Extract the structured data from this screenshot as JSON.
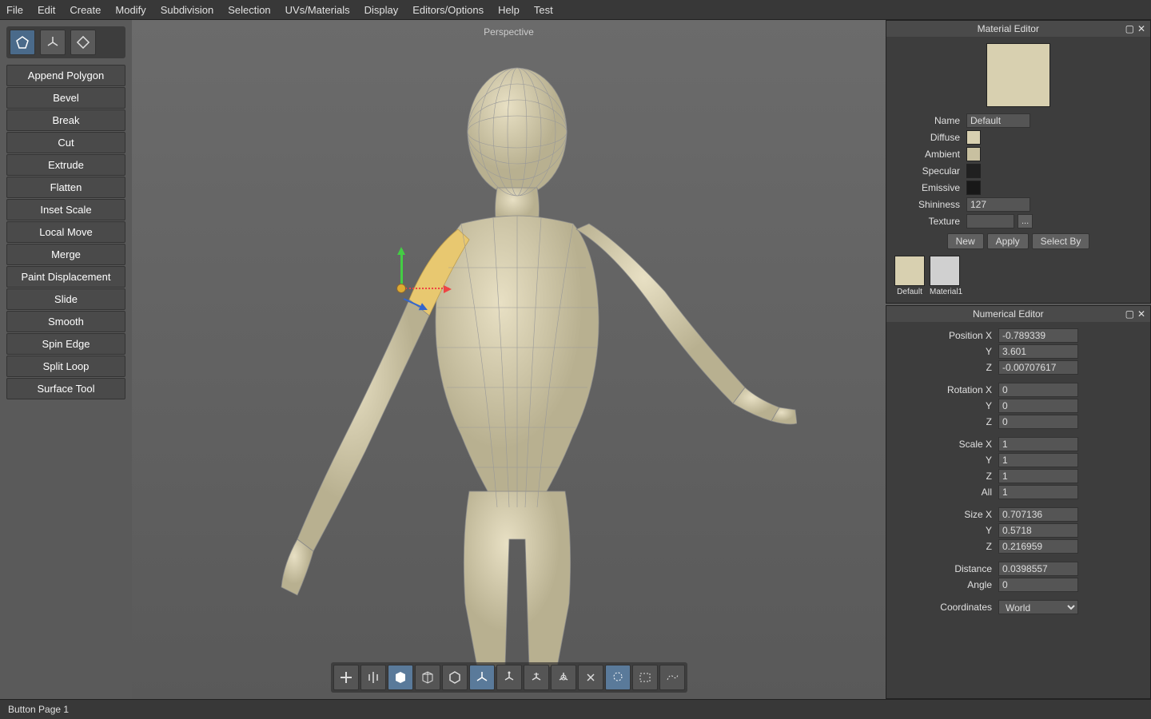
{
  "menu": [
    "File",
    "Edit",
    "Create",
    "Modify",
    "Subdivision",
    "Selection",
    "UVs/Materials",
    "Display",
    "Editors/Options",
    "Help",
    "Test"
  ],
  "viewport_label": "Perspective",
  "tool_buttons": [
    "Append Polygon",
    "Bevel",
    "Break",
    "Cut",
    "Extrude",
    "Flatten",
    "Inset Scale",
    "Local Move",
    "Merge",
    "Paint Displacement",
    "Slide",
    "Smooth",
    "Spin Edge",
    "Split Loop",
    "Surface Tool"
  ],
  "material_editor": {
    "title": "Material Editor",
    "name_label": "Name",
    "name_value": "Default",
    "diffuse_label": "Diffuse",
    "diffuse_color": "#d8d0b0",
    "ambient_label": "Ambient",
    "ambient_color": "#c8c0a0",
    "specular_label": "Specular",
    "specular_color": "#202020",
    "emissive_label": "Emissive",
    "emissive_color": "#181818",
    "shininess_label": "Shininess",
    "shininess_value": "127",
    "texture_label": "Texture",
    "texture_value": "",
    "browse": "...",
    "btn_new": "New",
    "btn_apply": "Apply",
    "btn_select": "Select By",
    "thumbs": [
      {
        "label": "Default",
        "color": "#d8d0b0"
      },
      {
        "label": "Material1",
        "color": "#d0d0d0"
      }
    ]
  },
  "numerical_editor": {
    "title": "Numerical Editor",
    "position_label": "Position X",
    "position_x": "-0.789339",
    "y_label": "Y",
    "position_y": "3.601",
    "z_label": "Z",
    "position_z": "-0.00707617",
    "rotation_label": "Rotation X",
    "rotation_x": "0",
    "rotation_y": "0",
    "rotation_z": "0",
    "scale_label": "Scale X",
    "scale_x": "1",
    "scale_y": "1",
    "scale_z": "1",
    "all_label": "All",
    "scale_all": "1",
    "size_label": "Size X",
    "size_x": "0.707136",
    "size_y": "0.5718",
    "size_z": "0.216959",
    "distance_label": "Distance",
    "distance": "0.0398557",
    "angle_label": "Angle",
    "angle": "0",
    "coords_label": "Coordinates",
    "coords_value": "World"
  },
  "statusbar": "Button Page 1"
}
